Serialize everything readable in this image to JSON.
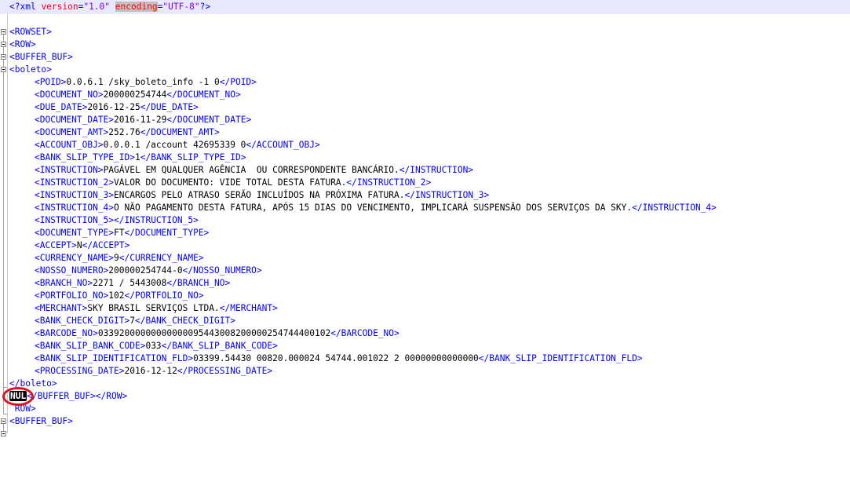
{
  "xml_declaration": {
    "open": "<?xml",
    "version_attr": "version",
    "version_eq": "=",
    "version_val": "\"1.0\"",
    "encoding_attr": "encoding",
    "encoding_eq": "=",
    "encoding_val": "\"UTF-8\"",
    "close": "?>"
  },
  "tags": {
    "rowset_open": "<ROWSET>",
    "row_open": "<ROW>",
    "buffer_open": "<BUFFER_BUF>",
    "boleto_open": "<boleto>",
    "boleto_close": "</boleto>",
    "buffer_row_close": "/BUFFER_BUF></ROW>",
    "row_open_partial": "ROW>",
    "buffer_open_2": "<BUFFER_BUF>"
  },
  "nul_marker": "NUL",
  "nul_lt": "<",
  "fields": [
    {
      "open": "<POID>",
      "value": "0.0.6.1 /sky_boleto_info -1 0",
      "close": "</POID>"
    },
    {
      "open": "<DOCUMENT_NO>",
      "value": "200000254744",
      "close": "</DOCUMENT_NO>"
    },
    {
      "open": "<DUE_DATE>",
      "value": "2016-12-25",
      "close": "</DUE_DATE>"
    },
    {
      "open": "<DOCUMENT_DATE>",
      "value": "2016-11-29",
      "close": "</DOCUMENT_DATE>"
    },
    {
      "open": "<DOCUMENT_AMT>",
      "value": "252.76",
      "close": "</DOCUMENT_AMT>"
    },
    {
      "open": "<ACCOUNT_OBJ>",
      "value": "0.0.0.1 /account 42695339 0",
      "close": "</ACCOUNT_OBJ>"
    },
    {
      "open": "<BANK_SLIP_TYPE_ID>",
      "value": "1",
      "close": "</BANK_SLIP_TYPE_ID>"
    },
    {
      "open": "<INSTRUCTION>",
      "value": "PAGÁVEL EM QUALQUER AGÊNCIA  OU CORRESPONDENTE BANCÁRIO.",
      "close": "</INSTRUCTION>"
    },
    {
      "open": "<INSTRUCTION_2>",
      "value": "VALOR DO DOCUMENTO: VIDE TOTAL DESTA FATURA.",
      "close": "</INSTRUCTION_2>"
    },
    {
      "open": "<INSTRUCTION_3>",
      "value": "ENCARGOS PELO ATRASO SERÃO INCLUÍDOS NA PRÓXIMA FATURA.",
      "close": "</INSTRUCTION_3>"
    },
    {
      "open": "<INSTRUCTION_4>",
      "value": "O NÃO PAGAMENTO DESTA FATURA, APÓS 15 DIAS DO VENCIMENTO, IMPLICARÁ SUSPENSÃO DOS SERVIÇOS DA SKY.",
      "close": "</INSTRUCTION_4>"
    },
    {
      "open": "<INSTRUCTION_5>",
      "value": "",
      "close": "</INSTRUCTION_5>"
    },
    {
      "open": "<DOCUMENT_TYPE>",
      "value": "FT",
      "close": "</DOCUMENT_TYPE>"
    },
    {
      "open": "<ACCEPT>",
      "value": "N",
      "close": "</ACCEPT>"
    },
    {
      "open": "<CURRENCY_NAME>",
      "value": "9",
      "close": "</CURRENCY_NAME>"
    },
    {
      "open": "<NOSSO_NUMERO>",
      "value": "200000254744-0",
      "close": "</NOSSO_NUMERO>"
    },
    {
      "open": "<BRANCH_NO>",
      "value": "2271 / 5443008",
      "close": "</BRANCH_NO>"
    },
    {
      "open": "<PORTFOLIO_NO>",
      "value": "102",
      "close": "</PORTFOLIO_NO>"
    },
    {
      "open": "<MERCHANT>",
      "value": "SKY BRASIL SERVIÇOS LTDA.",
      "close": "</MERCHANT>"
    },
    {
      "open": "<BANK_CHECK_DIGIT>",
      "value": "7",
      "close": "</BANK_CHECK_DIGIT>"
    },
    {
      "open": "<BARCODE_NO>",
      "value": "03392000000000000095443008200000254744400102",
      "close": "</BARCODE_NO>"
    },
    {
      "open": "<BANK_SLIP_BANK_CODE>",
      "value": "033",
      "close": "</BANK_SLIP_BANK_CODE>"
    },
    {
      "open": "<BANK_SLIP_IDENTIFICATION_FLD>",
      "value": "03399.54430 00820.000024 54744.001022 2 00000000000000",
      "close": "</BANK_SLIP_IDENTIFICATION_FLD>"
    },
    {
      "open": "<PROCESSING_DATE>",
      "value": "2016-12-12",
      "close": "</PROCESSING_DATE>"
    }
  ],
  "colors": {
    "tag": "#0000ff",
    "attribute": "#ff0000",
    "attribute_value": "#8000ff",
    "text": "#000000",
    "highlight_circle": "#e0101c",
    "current_line": "#e8e8ff"
  }
}
